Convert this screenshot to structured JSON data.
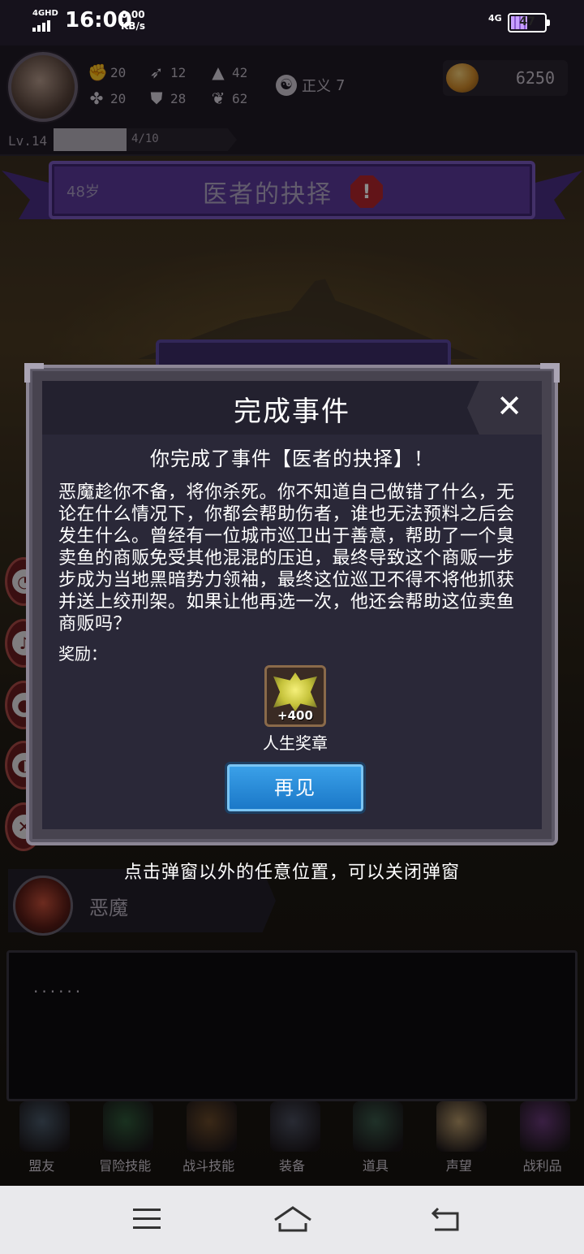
{
  "status_bar": {
    "network_type": "4GHD",
    "time": "16:00",
    "speed_value": "0.00",
    "speed_unit": "KB/s",
    "network_right": "4G",
    "battery": "47"
  },
  "player": {
    "stats": {
      "strength": "20",
      "luck": "20",
      "agility": "12",
      "constitution": "28",
      "magic": "42",
      "spirit": "62"
    },
    "alignment_label": "正义",
    "alignment_value": "7",
    "gold": "6250",
    "level": "Lv.14",
    "xp_text": "4/10",
    "xp_fraction": 0.4
  },
  "event_banner": {
    "age": "48岁",
    "title": "医者的抉择",
    "alert_icon": "!"
  },
  "modal": {
    "title": "完成事件",
    "close_glyph": "✕",
    "subtitle": "你完成了事件【医者的抉择】！",
    "body": "恶魔趁你不备，将你杀死。你不知道自己做错了什么，无论在什么情况下，你都会帮助伤者，谁也无法预料之后会发生什么。曾经有一位城市巡卫出于善意，帮助了一个臭卖鱼的商贩免受其他混混的压迫，最终导致这个商贩一步步成为当地黑暗势力领袖，最终这位巡卫不得不将他抓获并送上绞刑架。如果让他再选一次，他还会帮助这位卖鱼商贩吗？",
    "reward_label": "奖励：",
    "reward": {
      "name": "人生奖章",
      "quantity": "+400",
      "icon": "life-medal-icon"
    },
    "button_label": "再见"
  },
  "hint": "点击弹窗以外的任意位置，可以关闭弹窗",
  "dialogue": {
    "speaker": "恶魔",
    "text": "······"
  },
  "menu": {
    "items": [
      {
        "label": "盟友",
        "color": "#4a5a6a"
      },
      {
        "label": "冒险技能",
        "color": "#2f5a3a"
      },
      {
        "label": "战斗技能",
        "color": "#6a4a2a"
      },
      {
        "label": "装备",
        "color": "#4a4e5e"
      },
      {
        "label": "道具",
        "color": "#3a5a4a"
      },
      {
        "label": "声望",
        "color": "#b89a6a"
      },
      {
        "label": "战利品",
        "color": "#6a3a7a"
      }
    ]
  },
  "colors": {
    "accent_purple": "#5b3a9b",
    "button_blue": "#1b78c8",
    "alert_red": "#b3262c"
  }
}
